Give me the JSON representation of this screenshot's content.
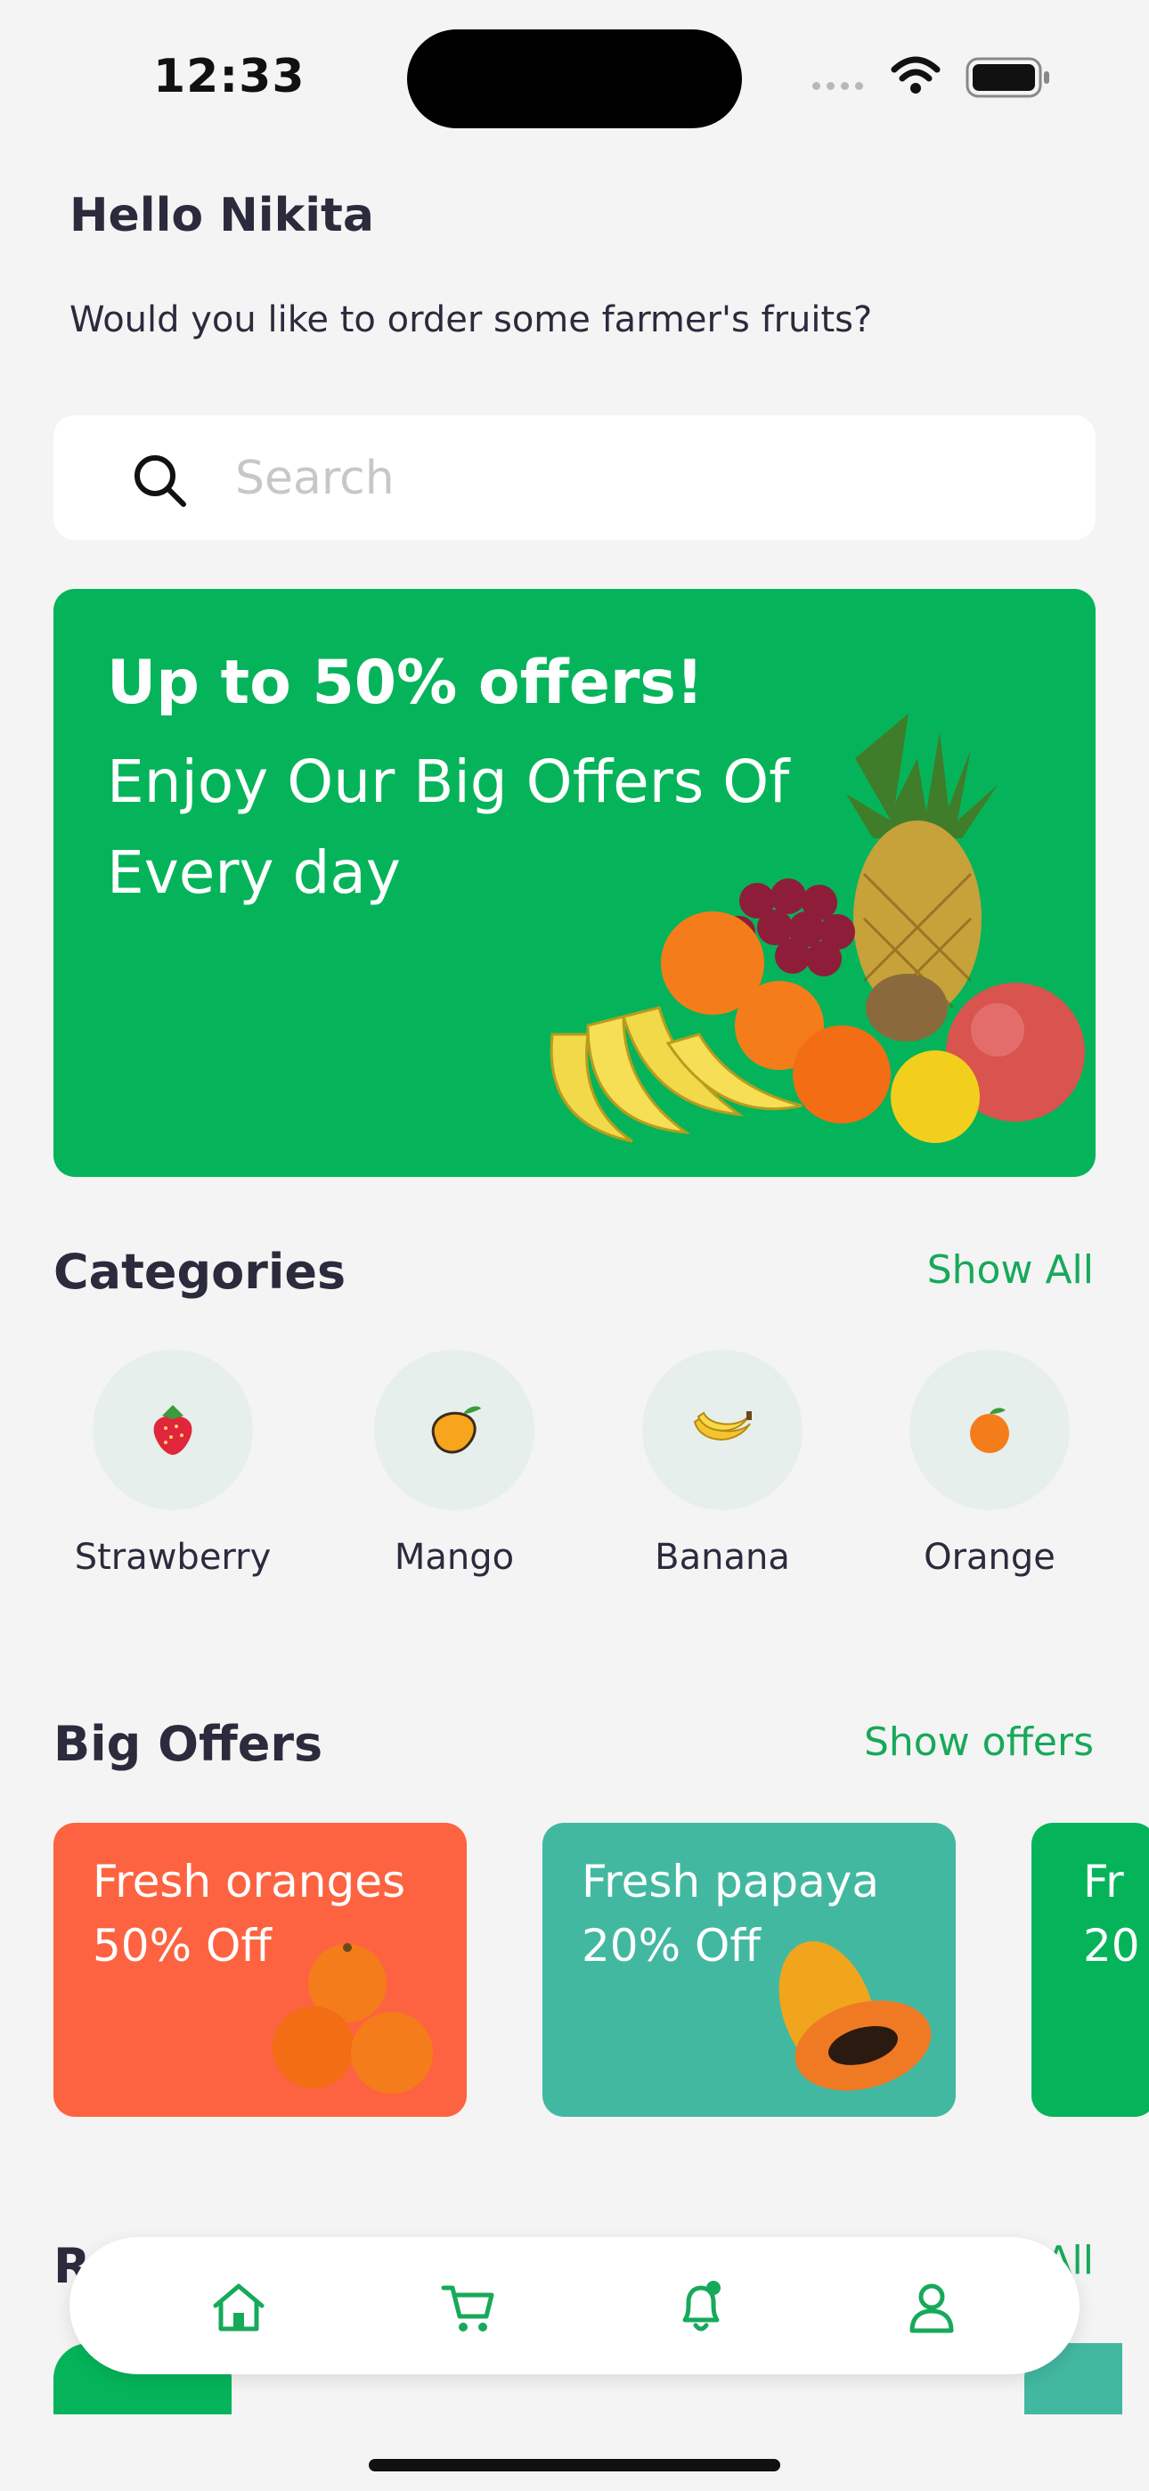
{
  "status": {
    "time": "12:33"
  },
  "greeting": {
    "title": "Hello Nikita",
    "subtitle": "Would you like to order some farmer's fruits?"
  },
  "search": {
    "placeholder": "Search",
    "value": ""
  },
  "banner": {
    "headline": "Up to 50% offers!",
    "body": "Enjoy Our Big Offers Of Every day",
    "color": "#05b45a"
  },
  "categories": {
    "title": "Categories",
    "link": "Show All",
    "items": [
      {
        "label": "Strawberry",
        "icon": "strawberry-icon"
      },
      {
        "label": "Mango",
        "icon": "mango-icon"
      },
      {
        "label": "Banana",
        "icon": "banana-icon"
      },
      {
        "label": "Orange",
        "icon": "orange-icon"
      }
    ]
  },
  "offers": {
    "title": "Big Offers",
    "link": "Show offers",
    "items": [
      {
        "title": "Fresh oranges",
        "discount": "50% Off",
        "color": "#fd6340"
      },
      {
        "title": "Fresh papaya",
        "discount": "20% Off",
        "color": "#43b8a1"
      },
      {
        "title": "Fr",
        "discount": "20",
        "color": "#05b45a"
      }
    ]
  },
  "next_section": {
    "title_partial": "R",
    "link_partial": "All"
  },
  "nav": [
    "home-icon",
    "cart-icon",
    "bell-icon",
    "user-icon"
  ],
  "accent": "#17a95a"
}
